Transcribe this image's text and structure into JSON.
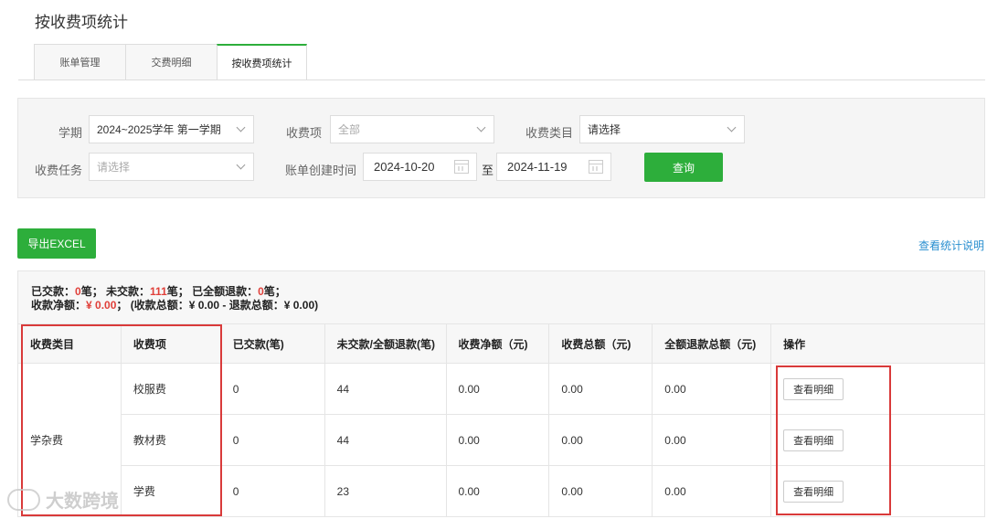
{
  "page": {
    "title": "按收费项统计"
  },
  "tabs": [
    {
      "label": "账单管理"
    },
    {
      "label": "交费明细"
    },
    {
      "label": "按收费项统计"
    }
  ],
  "filters": {
    "term_label": "学期",
    "term_value": "2024~2025学年 第一学期",
    "item_label": "收费项",
    "item_value": "全部",
    "category_label": "收费类目",
    "category_value": "请选择",
    "task_label": "收费任务",
    "task_placeholder": "请选择",
    "created_label": "账单创建时间",
    "date_from": "2024-10-20",
    "date_sep": "至",
    "date_to": "2024-11-19",
    "query_label": "查询"
  },
  "toolbar": {
    "export_label": "导出EXCEL",
    "help_link": "查看统计说明"
  },
  "summary": {
    "paid_prefix": "已交款：",
    "paid_count": "0",
    "paid_suffix": "笔；  未交款：",
    "unpaid_count": "111",
    "unpaid_suffix": "笔；  已全额退款：",
    "refund_count": "0",
    "refund_suffix": "笔；",
    "net_prefix": "收款净额：",
    "net_value": "¥ 0.00",
    "net_suffix": "；   (收款总额：¥ 0.00   -   退款总额：¥ 0.00)"
  },
  "table": {
    "headers": [
      "收费类目",
      "收费项",
      "已交款(笔)",
      "未交款/全额退款(笔)",
      "收费净额（元)",
      "收费总额（元)",
      "全额退款总额（元)",
      "操作"
    ],
    "category": "学杂费",
    "rows": [
      {
        "item": "校服费",
        "paid": "0",
        "unpaid": "44",
        "net": "0.00",
        "total": "0.00",
        "refund": "0.00",
        "action": "查看明细"
      },
      {
        "item": "教材费",
        "paid": "0",
        "unpaid": "44",
        "net": "0.00",
        "total": "0.00",
        "refund": "0.00",
        "action": "查看明细"
      },
      {
        "item": "学费",
        "paid": "0",
        "unpaid": "23",
        "net": "0.00",
        "total": "0.00",
        "refund": "0.00",
        "action": "查看明细"
      }
    ]
  },
  "watermark": {
    "text": "大数跨境"
  },
  "colors": {
    "accent": "#2dae3b",
    "highlight": "#e0403a",
    "link": "#2a8fd0",
    "annotation": "#d93a3a"
  }
}
